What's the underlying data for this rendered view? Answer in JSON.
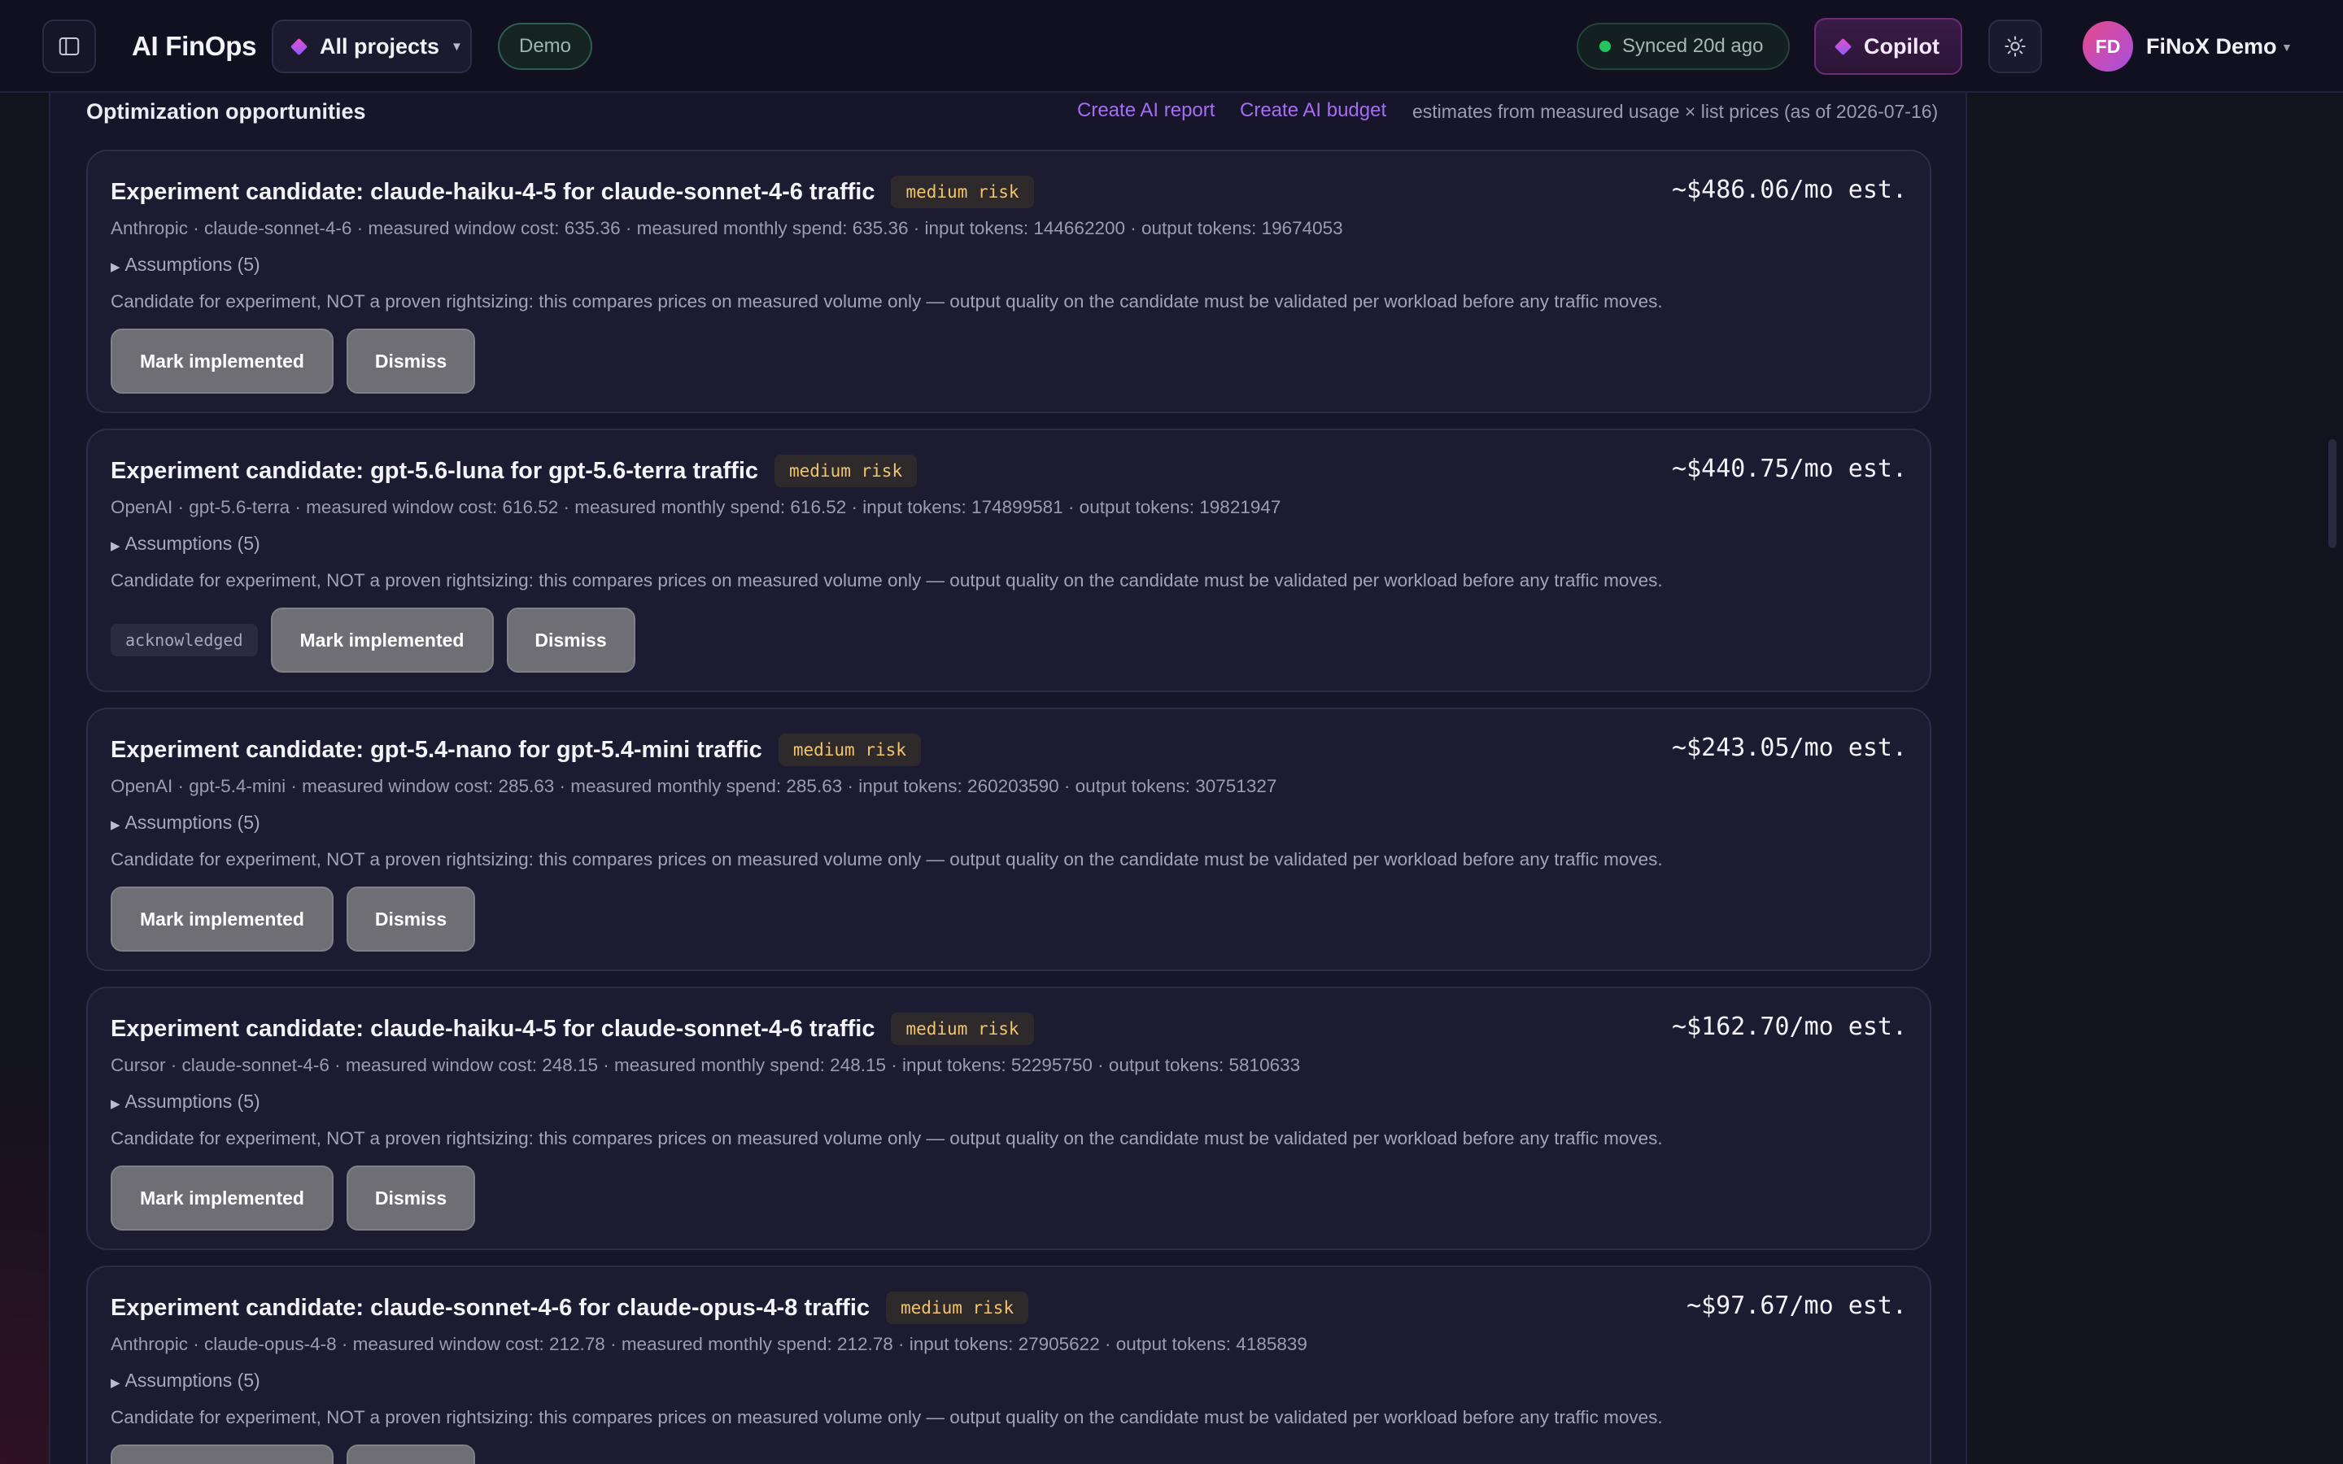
{
  "app": {
    "title": "AI FinOps",
    "project_selector": "All projects",
    "env_badge": "Demo",
    "sync_status": "Synced 20d ago",
    "copilot_label": "Copilot",
    "user_initials": "FD",
    "user_name": "FiNoX Demo"
  },
  "section": {
    "title": "Optimization opportunities",
    "create_report": "Create AI report",
    "create_budget": "Create AI budget",
    "estimate_note": "estimates from measured usage × list prices (as of 2026-07-16)"
  },
  "labels": {
    "mark_implemented": "Mark implemented",
    "dismiss": "Dismiss",
    "assumptions": "Assumptions (5)",
    "risk": "medium risk",
    "acknowledged": "acknowledged"
  },
  "cards": [
    {
      "title": "Experiment candidate: claude-haiku-4-5 for claude-sonnet-4-6 traffic",
      "savings": "~$486.06/mo est.",
      "meta": "Anthropic · claude-sonnet-4-6 · measured window cost: 635.36 · measured monthly spend: 635.36 · input tokens: 144662200 · output tokens: 19674053",
      "note": "Candidate for experiment, NOT a proven rightsizing: this compares prices on measured volume only — output quality on the candidate must be validated per workload before any traffic moves."
    },
    {
      "title": "Experiment candidate: gpt-5.6-luna for gpt-5.6-terra traffic",
      "savings": "~$440.75/mo est.",
      "meta": "OpenAI · gpt-5.6-terra · measured window cost: 616.52 · measured monthly spend: 616.52 · input tokens: 174899581 · output tokens: 19821947",
      "note": "Candidate for experiment, NOT a proven rightsizing: this compares prices on measured volume only — output quality on the candidate must be validated per workload before any traffic moves."
    },
    {
      "title": "Experiment candidate: gpt-5.4-nano for gpt-5.4-mini traffic",
      "savings": "~$243.05/mo est.",
      "meta": "OpenAI · gpt-5.4-mini · measured window cost: 285.63 · measured monthly spend: 285.63 · input tokens: 260203590 · output tokens: 30751327",
      "note": "Candidate for experiment, NOT a proven rightsizing: this compares prices on measured volume only — output quality on the candidate must be validated per workload before any traffic moves."
    },
    {
      "title": "Experiment candidate: claude-haiku-4-5 for claude-sonnet-4-6 traffic",
      "savings": "~$162.70/mo est.",
      "meta": "Cursor · claude-sonnet-4-6 · measured window cost: 248.15 · measured monthly spend: 248.15 · input tokens: 52295750 · output tokens: 5810633",
      "note": "Candidate for experiment, NOT a proven rightsizing: this compares prices on measured volume only — output quality on the candidate must be validated per workload before any traffic moves."
    },
    {
      "title": "Experiment candidate: claude-sonnet-4-6 for claude-opus-4-8 traffic",
      "savings": "~$97.67/mo est.",
      "meta": "Anthropic · claude-opus-4-8 · measured window cost: 212.78 · measured monthly spend: 212.78 · input tokens: 27905622 · output tokens: 4185839",
      "note": "Candidate for experiment, NOT a proven rightsizing: this compares prices on measured volume only — output quality on the candidate must be validated per workload before any traffic moves."
    }
  ],
  "colors": {
    "accent_link": "#a66cf5",
    "risk_text": "#f2c46d",
    "sync_dot": "#22c55e"
  }
}
